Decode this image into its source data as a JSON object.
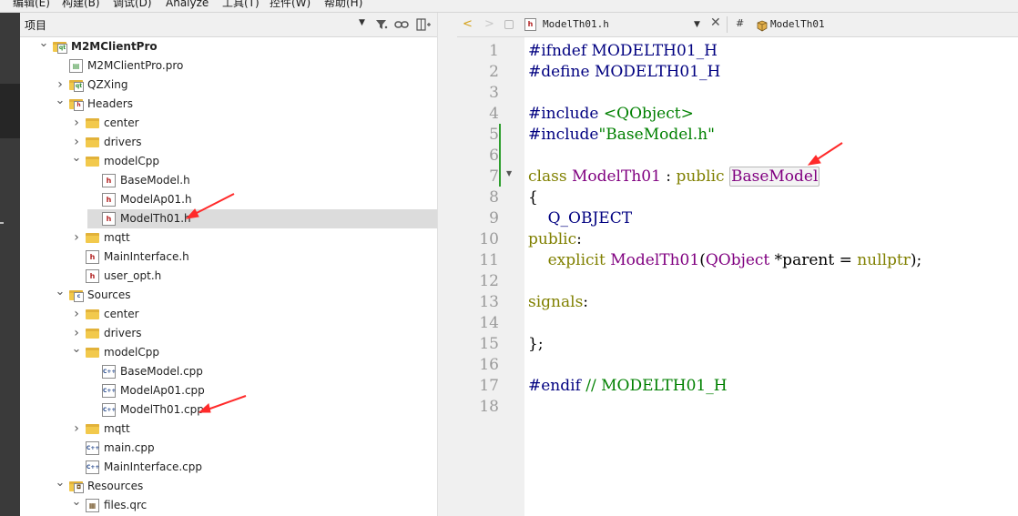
{
  "menu": [
    "编辑(E)",
    "构建(B)",
    "调试(D)",
    "Analyze",
    "工具(T)",
    "控件(W)",
    "帮助(H)"
  ],
  "project_panel": {
    "title": "项目",
    "tree": [
      {
        "label": "M2MClientPro",
        "depth": 0,
        "expand": "open",
        "icon": "project-icon",
        "bold": true
      },
      {
        "label": "M2MClientPro.pro",
        "depth": 1,
        "expand": "none",
        "icon": "pro-file-icon"
      },
      {
        "label": "QZXing",
        "depth": 1,
        "expand": "closed",
        "icon": "project-icon"
      },
      {
        "label": "Headers",
        "depth": 1,
        "expand": "open",
        "icon": "headers-folder-icon"
      },
      {
        "label": "center",
        "depth": 2,
        "expand": "closed",
        "icon": "folder-icon"
      },
      {
        "label": "drivers",
        "depth": 2,
        "expand": "closed",
        "icon": "folder-icon"
      },
      {
        "label": "modelCpp",
        "depth": 2,
        "expand": "open",
        "icon": "folder-icon"
      },
      {
        "label": "BaseModel.h",
        "depth": 3,
        "expand": "none",
        "icon": "header-file-icon"
      },
      {
        "label": "ModelAp01.h",
        "depth": 3,
        "expand": "none",
        "icon": "header-file-icon"
      },
      {
        "label": "ModelTh01.h",
        "depth": 3,
        "expand": "none",
        "icon": "header-file-icon",
        "selected": true
      },
      {
        "label": "mqtt",
        "depth": 2,
        "expand": "closed",
        "icon": "folder-icon"
      },
      {
        "label": "MainInterface.h",
        "depth": 2,
        "expand": "none",
        "icon": "header-file-icon"
      },
      {
        "label": "user_opt.h",
        "depth": 2,
        "expand": "none",
        "icon": "header-file-icon"
      },
      {
        "label": "Sources",
        "depth": 1,
        "expand": "open",
        "icon": "sources-folder-icon"
      },
      {
        "label": "center",
        "depth": 2,
        "expand": "closed",
        "icon": "folder-icon"
      },
      {
        "label": "drivers",
        "depth": 2,
        "expand": "closed",
        "icon": "folder-icon"
      },
      {
        "label": "modelCpp",
        "depth": 2,
        "expand": "open",
        "icon": "folder-icon"
      },
      {
        "label": "BaseModel.cpp",
        "depth": 3,
        "expand": "none",
        "icon": "cpp-file-icon"
      },
      {
        "label": "ModelAp01.cpp",
        "depth": 3,
        "expand": "none",
        "icon": "cpp-file-icon"
      },
      {
        "label": "ModelTh01.cpp",
        "depth": 3,
        "expand": "none",
        "icon": "cpp-file-icon"
      },
      {
        "label": "mqtt",
        "depth": 2,
        "expand": "closed",
        "icon": "folder-icon"
      },
      {
        "label": "main.cpp",
        "depth": 2,
        "expand": "none",
        "icon": "cpp-file-icon"
      },
      {
        "label": "MainInterface.cpp",
        "depth": 2,
        "expand": "none",
        "icon": "cpp-file-icon"
      },
      {
        "label": "Resources",
        "depth": 1,
        "expand": "open",
        "icon": "resources-folder-icon"
      },
      {
        "label": "files.qrc",
        "depth": 2,
        "expand": "open",
        "icon": "qrc-file-icon"
      }
    ]
  },
  "editor": {
    "document": "ModelTh01.h",
    "symbol": "ModelTh01",
    "symbol_prefix": "#",
    "lines": [
      [
        {
          "t": "#ifndef MODELTH01_H",
          "c": "pp"
        }
      ],
      [
        {
          "t": "#define MODELTH01_H",
          "c": "pp"
        }
      ],
      [],
      [
        {
          "t": "#include ",
          "c": "pp"
        },
        {
          "t": "<QObject>",
          "c": "str"
        }
      ],
      [
        {
          "t": "#include",
          "c": "pp"
        },
        {
          "t": "\"BaseModel.h\"",
          "c": "str"
        }
      ],
      [],
      [
        {
          "t": "class ",
          "c": "kw"
        },
        {
          "t": "ModelTh01",
          "c": "ty"
        },
        {
          "t": " : ",
          "c": ""
        },
        {
          "t": "public ",
          "c": "kw"
        },
        {
          "t": "BaseModel",
          "c": "ty hl"
        }
      ],
      [
        {
          "t": "{",
          "c": ""
        }
      ],
      [
        {
          "t": "    Q_OBJECT",
          "c": "pp"
        }
      ],
      [
        {
          "t": "public",
          "c": "kw"
        },
        {
          "t": ":",
          "c": ""
        }
      ],
      [
        {
          "t": "    ",
          "c": ""
        },
        {
          "t": "explicit ",
          "c": "kw"
        },
        {
          "t": "ModelTh01",
          "c": "ty"
        },
        {
          "t": "(",
          "c": ""
        },
        {
          "t": "QObject",
          "c": "ty"
        },
        {
          "t": " *parent = ",
          "c": ""
        },
        {
          "t": "nullptr",
          "c": "kw"
        },
        {
          "t": ");",
          "c": ""
        }
      ],
      [],
      [
        {
          "t": "signals",
          "c": "kw"
        },
        {
          "t": ":",
          "c": ""
        }
      ],
      [],
      [
        {
          "t": "};",
          "c": ""
        }
      ],
      [],
      [
        {
          "t": "#endif ",
          "c": "pp"
        },
        {
          "t": "// MODELTH01_H",
          "c": "str"
        }
      ],
      []
    ],
    "line_numbers": [
      "1",
      "2",
      "3",
      "4",
      "5",
      "6",
      "7",
      "8",
      "9",
      "10",
      "11",
      "12",
      "13",
      "14",
      "15",
      "16",
      "17",
      "18"
    ]
  },
  "colors": {
    "annotation_arrow": "#ff2a2a",
    "changed_lines": "#2e9e2e"
  }
}
